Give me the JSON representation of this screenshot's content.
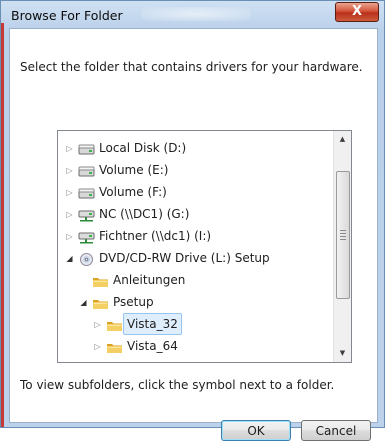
{
  "window": {
    "title": "Browse For Folder",
    "close_glyph": "X",
    "close_icon": "close-icon"
  },
  "instruction": "Select the folder that contains drivers for your hardware.",
  "tree": {
    "items": [
      {
        "label": "Local Disk (D:)",
        "icon": "hard-drive-icon",
        "expander": "collapsed",
        "level": 0
      },
      {
        "label": "Volume (E:)",
        "icon": "hard-drive-icon",
        "expander": "collapsed",
        "level": 0
      },
      {
        "label": "Volume (F:)",
        "icon": "hard-drive-icon",
        "expander": "collapsed",
        "level": 0
      },
      {
        "label": "NC (\\\\DC1) (G:)",
        "icon": "network-drive-icon",
        "expander": "collapsed",
        "level": 0
      },
      {
        "label": "Fichtner (\\\\dc1) (I:)",
        "icon": "network-drive-icon",
        "expander": "collapsed",
        "level": 0
      },
      {
        "label": "DVD/CD-RW Drive (L:) Setup",
        "icon": "cd-drive-icon",
        "expander": "expanded",
        "level": 0
      },
      {
        "label": "Anleitungen",
        "icon": "folder-icon",
        "expander": "none",
        "level": 1
      },
      {
        "label": "Psetup",
        "icon": "folder-icon",
        "expander": "expanded",
        "level": 1
      },
      {
        "label": "Vista_32",
        "icon": "folder-icon",
        "expander": "collapsed",
        "level": 2,
        "selected": true
      },
      {
        "label": "Vista_64",
        "icon": "folder-icon",
        "expander": "collapsed",
        "level": 2
      }
    ]
  },
  "hint": "To view subfolders, click the symbol next to a folder.",
  "buttons": {
    "ok": "OK",
    "cancel": "Cancel"
  },
  "colors": {
    "frame": "#bcd2ea",
    "close_button": "#c9452b",
    "selection": "#dfeefd",
    "folder": "#e8b93a"
  }
}
